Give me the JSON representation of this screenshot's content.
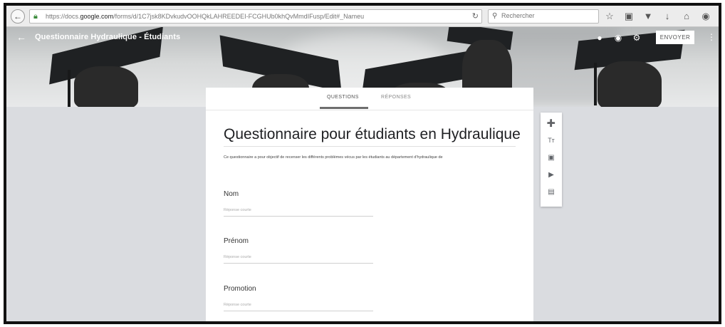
{
  "browser": {
    "back_icon": "back-arrow-icon",
    "lock_icon": "lock-icon",
    "url_prefix": "https://docs.",
    "url_domain": "google.com",
    "url_rest": "/forms/d/1C7jsk8KDvkudvOOHQkLAHREEDEI-FCGHUb0khQvMmdIFusp/Edit#_Nameu",
    "reload_icon": "reload-icon",
    "search_placeholder": "Rechercher",
    "toolbar_icons": [
      "star-icon",
      "clipboard-icon",
      "pocket-icon",
      "download-icon",
      "home-icon",
      "profile-icon",
      "menu-icon"
    ]
  },
  "header": {
    "form_title": "Questionnaire Hydraulique - Étudiants",
    "send_label": "ENVOYER",
    "icons": [
      "palette-icon",
      "preview-eye-icon",
      "settings-gear-icon"
    ]
  },
  "tabs": {
    "questions": "QUESTIONS",
    "responses": "RÉPONSES"
  },
  "form": {
    "title": "Questionnaire pour étudiants en Hydraulique",
    "description": "Ce questionnaire a pour objectif de recenser les différents problèmes vécus par les étudiants au département d'hydraulique de",
    "questions": [
      {
        "label": "Nom",
        "hint": "Réponse courte"
      },
      {
        "label": "Prénom",
        "hint": "Réponse courte"
      },
      {
        "label": "Promotion",
        "hint": "Réponse courte"
      }
    ]
  },
  "toolbox": {
    "tools": [
      "add-question-icon",
      "add-title-icon",
      "add-image-icon",
      "add-video-icon",
      "add-section-icon"
    ],
    "title_glyph": "Tт"
  },
  "colors": {
    "background": "#dadce0",
    "card": "#ffffff",
    "tab_underline": "#6e6e6e"
  }
}
